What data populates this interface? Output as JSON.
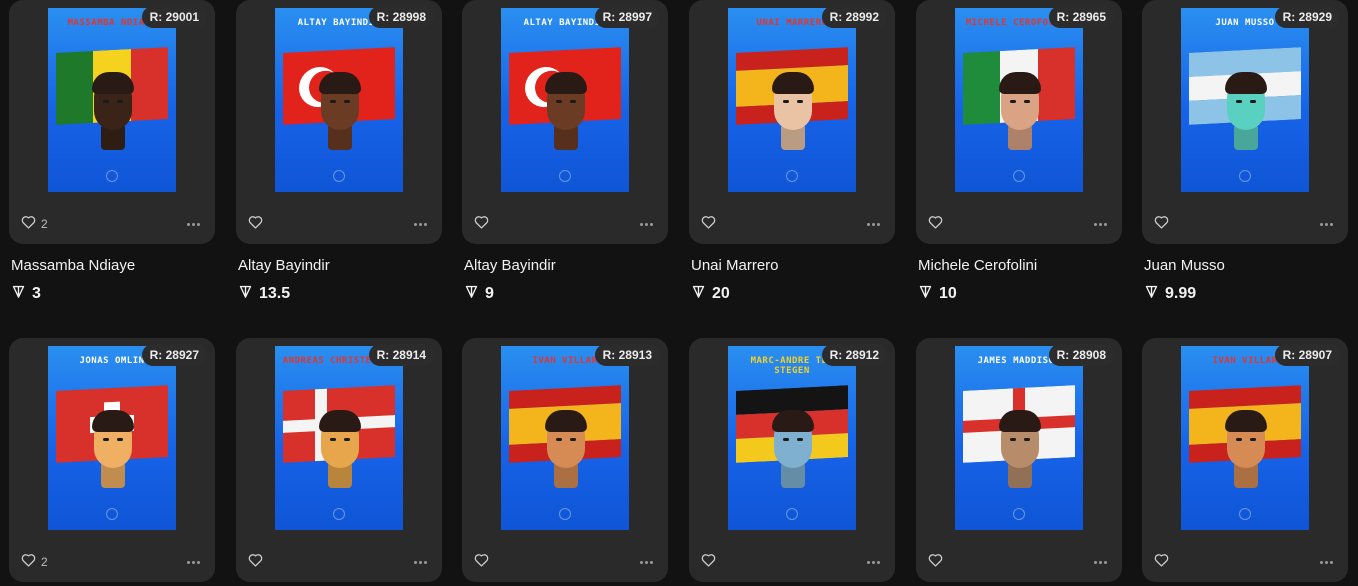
{
  "colors": {
    "background": "#121212",
    "card": "#2a2a2a",
    "badge": "#2c2c2c",
    "poster_top": "#2a8ff0",
    "poster_bottom": "#0f55d6"
  },
  "icons": {
    "like": "heart-icon",
    "menu": "more-horizontal-icon",
    "currency": "ton-icon"
  },
  "items": [
    {
      "rating": "R: 29001",
      "poster_name": "MASSAMBA NDIAYE",
      "title": "Massamba Ndiaye",
      "price": "3",
      "likes": "2",
      "flag": "senegal",
      "name_color": "red",
      "skin": "#3a2418"
    },
    {
      "rating": "R: 28998",
      "poster_name": "ALTAY BAYINDIR",
      "title": "Altay Bayindir",
      "price": "13.5",
      "likes": "",
      "flag": "turkey",
      "name_color": "white",
      "skin": "#6b3b24"
    },
    {
      "rating": "R: 28997",
      "poster_name": "ALTAY BAYINDIR",
      "title": "Altay Bayindir",
      "price": "9",
      "likes": "",
      "flag": "turkey",
      "name_color": "white",
      "skin": "#6b3b24"
    },
    {
      "rating": "R: 28992",
      "poster_name": "UNAI MARRERO",
      "title": "Unai Marrero",
      "price": "20",
      "likes": "",
      "flag": "spain",
      "name_color": "red",
      "skin": "#e9c3a4"
    },
    {
      "rating": "R: 28965",
      "poster_name": "MICHELE CEROFOLINI",
      "title": "Michele Cerofolini",
      "price": "10",
      "likes": "",
      "flag": "italy",
      "name_color": "red",
      "skin": "#d9a384"
    },
    {
      "rating": "R: 28929",
      "poster_name": "JUAN MUSSO",
      "title": "Juan Musso",
      "price": "9.99",
      "likes": "",
      "flag": "argentina",
      "name_color": "white",
      "skin": "#5ad0c0"
    },
    {
      "rating": "R: 28927",
      "poster_name": "JONAS OMLIN",
      "title": "",
      "price": "",
      "likes": "2",
      "flag": "switzerland",
      "name_color": "white",
      "skin": "#f0b063"
    },
    {
      "rating": "R: 28914",
      "poster_name": "ANDREAS CHRISTENSEN",
      "title": "",
      "price": "",
      "likes": "",
      "flag": "denmark",
      "name_color": "red",
      "skin": "#e7a64b"
    },
    {
      "rating": "R: 28913",
      "poster_name": "IVAN VILLAR",
      "title": "",
      "price": "",
      "likes": "",
      "flag": "spain",
      "name_color": "red",
      "skin": "#d68b55"
    },
    {
      "rating": "R: 28912",
      "poster_name": "MARC-ANDRE TER STEGEN",
      "title": "",
      "price": "",
      "likes": "",
      "flag": "germany",
      "name_color": "yellow",
      "skin": "#7fb0cf"
    },
    {
      "rating": "R: 28908",
      "poster_name": "JAMES MADDISON",
      "title": "",
      "price": "",
      "likes": "",
      "flag": "england",
      "name_color": "white",
      "skin": "#b78c6a"
    },
    {
      "rating": "R: 28907",
      "poster_name": "IVAN VILLAR",
      "title": "",
      "price": "",
      "likes": "",
      "flag": "spain",
      "name_color": "red",
      "skin": "#d68b55"
    }
  ]
}
